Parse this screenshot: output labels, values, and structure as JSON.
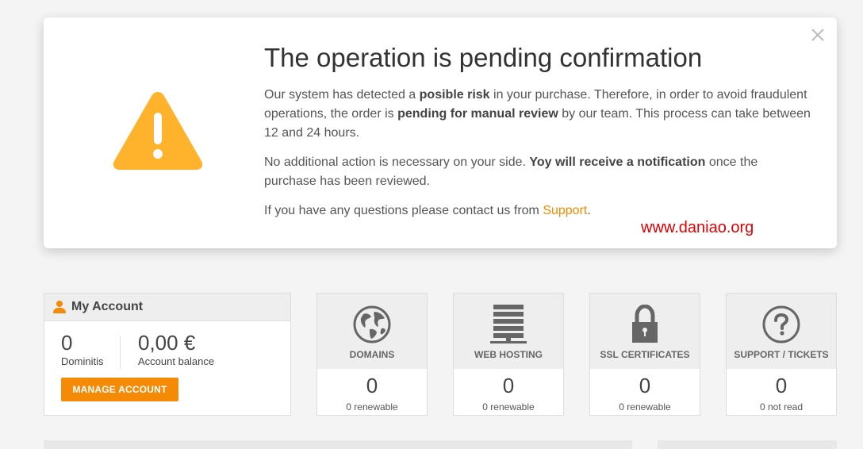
{
  "modal": {
    "title": "The operation is pending confirmation",
    "p1_a": "Our system has detected a ",
    "p1_b": "posible risk",
    "p1_c": " in your purchase. Therefore, in order to avoid fraudulent operations, the order is ",
    "p1_d": "pending for manual review",
    "p1_e": " by our team. This process can take between 12 and 24 hours.",
    "p2_a": "No additional action is necessary on your side. ",
    "p2_b": "Yoy will receive a notification",
    "p2_c": " once the purchase has been reviewed.",
    "p3_a": "If you have any questions please contact us from ",
    "p3_link": "Support",
    "p3_end": ".",
    "close_icon": "close-icon",
    "warning_icon": "warning-triangle-icon",
    "warning_color": "#ffb22b"
  },
  "watermark": "www.daniao.org",
  "account": {
    "title": "My Account",
    "icon": "user-icon",
    "dominitis_value": "0",
    "dominitis_label": "Dominitis",
    "balance_value": "0,00 €",
    "balance_label": "Account balance",
    "manage_label": "MANAGE ACCOUNT",
    "accent": "#f58a07"
  },
  "tiles": [
    {
      "label": "DOMAINS",
      "count": "0",
      "sub": "0 renewable",
      "icon": "globe-icon"
    },
    {
      "label": "WEB HOSTING",
      "count": "0",
      "sub": "0 renewable",
      "icon": "server-icon"
    },
    {
      "label": "SSL CERTIFICATES",
      "count": "0",
      "sub": "0 renewable",
      "icon": "lock-icon"
    },
    {
      "label": "SUPPORT / TICKETS",
      "count": "0",
      "sub": "0 not read",
      "icon": "question-icon"
    }
  ]
}
